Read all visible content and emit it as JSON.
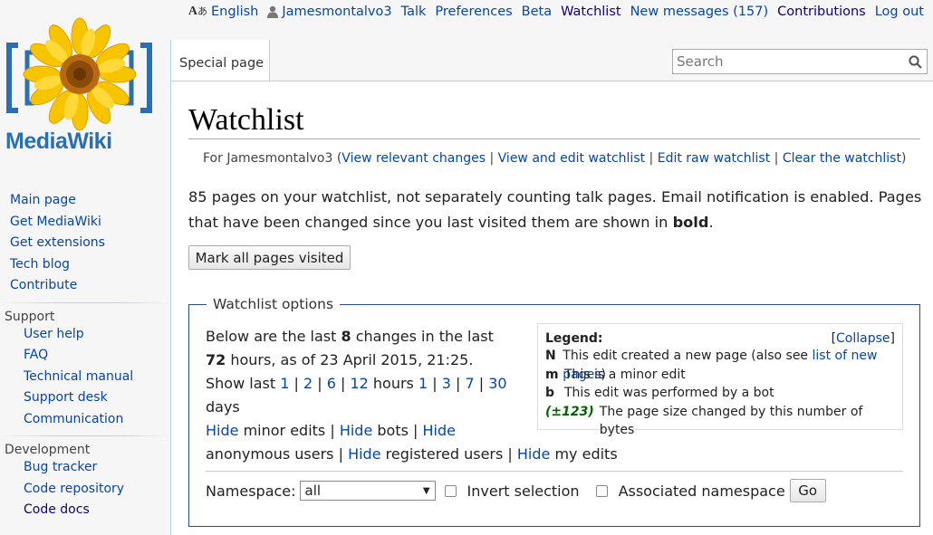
{
  "personal": {
    "language_icon_main": "A",
    "language_icon_sub": "あ",
    "language": "English",
    "username": "Jamesmontalvo3",
    "talk": "Talk",
    "preferences": "Preferences",
    "beta": "Beta",
    "watchlist": "Watchlist",
    "new_messages": "New messages (157)",
    "contributions": "Contributions",
    "logout": "Log out"
  },
  "logo": {
    "wordmark": "MediaWiki"
  },
  "sidebar": {
    "main": [
      "Main page",
      "Get MediaWiki",
      "Get extensions",
      "Tech blog",
      "Contribute"
    ],
    "support_heading": "Support",
    "support": [
      "User help",
      "FAQ",
      "Technical manual",
      "Support desk",
      "Communication"
    ],
    "development_heading": "Development",
    "development": [
      "Bug tracker",
      "Code repository",
      "Code docs"
    ]
  },
  "tabs": {
    "special": "Special page"
  },
  "search": {
    "placeholder": "Search"
  },
  "page": {
    "title": "Watchlist",
    "subtitle": {
      "prefix": "For Jamesmontalvo3 (",
      "view_relevant": "View relevant changes",
      "sep": " | ",
      "view_edit": "View and edit watchlist",
      "edit_raw": "Edit raw watchlist",
      "clear": "Clear the watchlist",
      "suffix": ")"
    },
    "summary_text": "85 pages on your watchlist, not separately counting talk pages. Email notification is enabled. Pages that have been changed since you last visited them are shown in ",
    "summary_bold": "bold",
    "summary_end": ".",
    "mark_all_button": "Mark all pages visited"
  },
  "options": {
    "legend": "Watchlist options",
    "intro_1": "Below are the last ",
    "changes_count": "8",
    "intro_2": " changes in the last ",
    "hours_count": "72",
    "intro_3": " hours, as of 23 April 2015, 21:25.",
    "show_last": "Show last ",
    "hours_links": [
      "1",
      "2",
      "6",
      "12"
    ],
    "hours_word": " hours ",
    "days_links": [
      "1",
      "3",
      "7",
      "30"
    ],
    "days_word": "days",
    "hide": "Hide",
    "minor_edits": " minor edits | ",
    "bots": " bots | ",
    "anonymous_users": "anonymous users | ",
    "registered_users": " registered users | ",
    "my_edits": " my edits",
    "namespace_label": "Namespace:",
    "namespace_value": "all",
    "invert_selection": "Invert selection",
    "associated_namespace": "Associated namespace",
    "go_button": "Go"
  },
  "legendbox": {
    "title": "Legend:",
    "collapse": "Collapse",
    "new_key": "N",
    "new_desc": "This edit created a new page (also see ",
    "new_link": "list of new pages",
    "new_end": ")",
    "minor_key": "m",
    "minor_desc": "This is a minor edit",
    "bot_key": "b",
    "bot_desc": "This edit was performed by a bot",
    "size_key": "(±123)",
    "size_desc": "The page size changed by this number of bytes"
  }
}
